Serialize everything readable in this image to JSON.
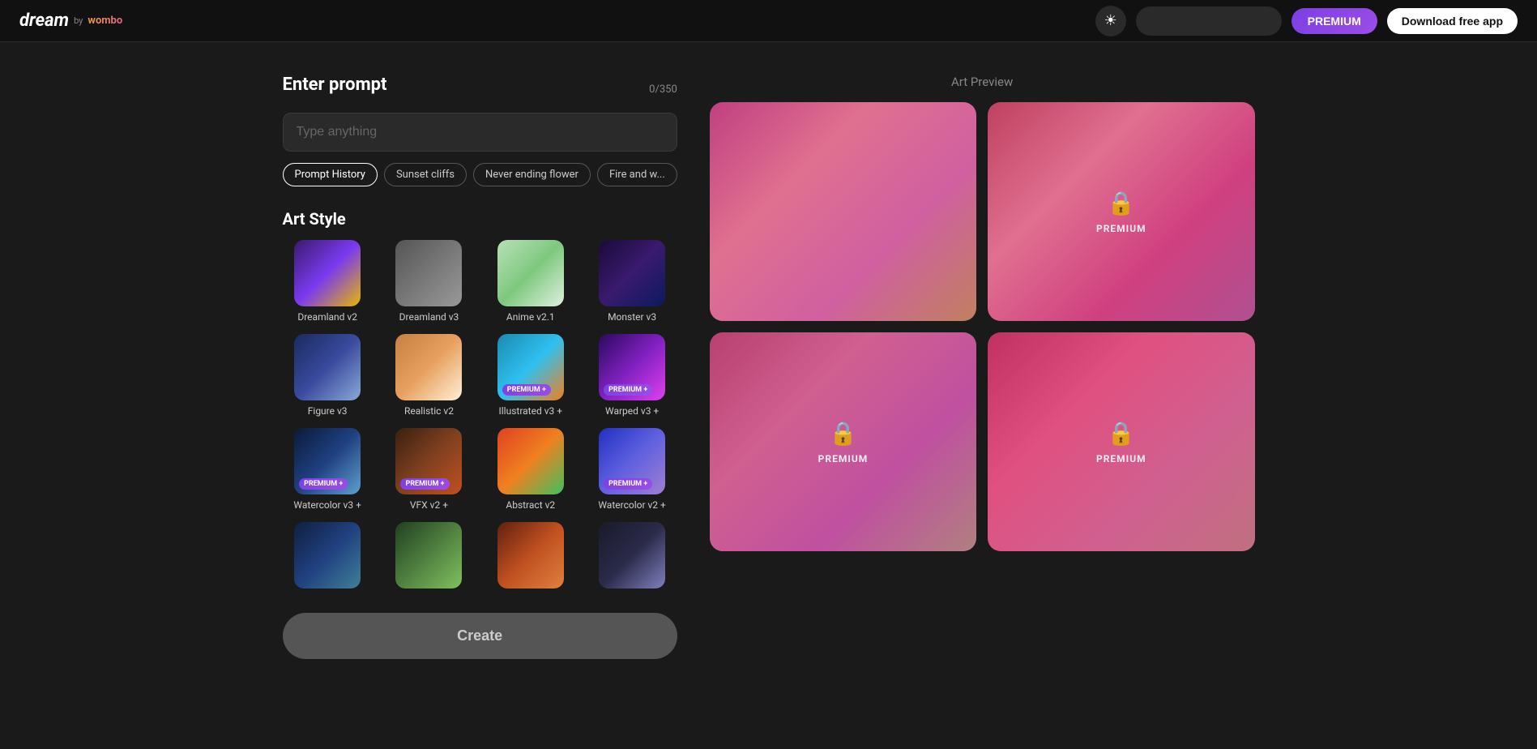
{
  "header": {
    "logo_dream": "dream",
    "logo_by": "by",
    "logo_wombo": "wombo",
    "theme_icon": "☀",
    "premium_label": "PREMIUM",
    "download_label": "Download free app",
    "search_placeholder": ""
  },
  "prompt_section": {
    "label": "Enter prompt",
    "char_count": "0/350",
    "input_placeholder": "Type anything",
    "chips": [
      {
        "label": "Prompt History",
        "active": true
      },
      {
        "label": "Sunset cliffs",
        "active": false
      },
      {
        "label": "Never ending flower",
        "active": false
      },
      {
        "label": "Fire and w...",
        "active": false
      }
    ]
  },
  "art_style": {
    "label": "Art Style",
    "items": [
      {
        "name": "Dreamland v2",
        "thumb_class": "thumb-dreamland-v2",
        "premium": false
      },
      {
        "name": "Dreamland v3",
        "thumb_class": "thumb-dreamland-v3",
        "premium": false
      },
      {
        "name": "Anime v2.1",
        "thumb_class": "thumb-anime-v21",
        "premium": false
      },
      {
        "name": "Monster v3",
        "thumb_class": "thumb-monster-v3",
        "premium": false
      },
      {
        "name": "Figure v3",
        "thumb_class": "thumb-figure-v3",
        "premium": false
      },
      {
        "name": "Realistic v2",
        "thumb_class": "thumb-realistic-v2",
        "premium": false
      },
      {
        "name": "Illustrated v3 +",
        "thumb_class": "thumb-illustrated-v3",
        "premium": true
      },
      {
        "name": "Warped v3 +",
        "thumb_class": "thumb-warped-v3",
        "premium": true
      },
      {
        "name": "Watercolor v3 +",
        "thumb_class": "thumb-watercolor-v3",
        "premium": true
      },
      {
        "name": "VFX v2 +",
        "thumb_class": "thumb-vfx-v2",
        "premium": true
      },
      {
        "name": "Abstract v2",
        "thumb_class": "thumb-abstract-v2",
        "premium": false
      },
      {
        "name": "Watercolor v2 +",
        "thumb_class": "thumb-watercolor-v2",
        "premium": true
      },
      {
        "name": "",
        "thumb_class": "thumb-row4-1",
        "premium": false
      },
      {
        "name": "",
        "thumb_class": "thumb-row4-2",
        "premium": false
      },
      {
        "name": "",
        "thumb_class": "thumb-row4-3",
        "premium": false
      },
      {
        "name": "",
        "thumb_class": "thumb-row4-4",
        "premium": false
      }
    ]
  },
  "create": {
    "label": "Create"
  },
  "art_preview": {
    "label": "Art Preview",
    "cells": [
      {
        "type": "image",
        "gradient": "preview-cell-1",
        "premium": false
      },
      {
        "type": "locked",
        "gradient": "preview-cell-2",
        "premium": true,
        "premium_label": "PREMIUM"
      },
      {
        "type": "locked",
        "gradient": "preview-cell-3",
        "premium": true,
        "premium_label": "PREMIUM"
      },
      {
        "type": "locked",
        "gradient": "preview-cell-4",
        "premium": true,
        "premium_label": "PREMIUM"
      }
    ]
  }
}
